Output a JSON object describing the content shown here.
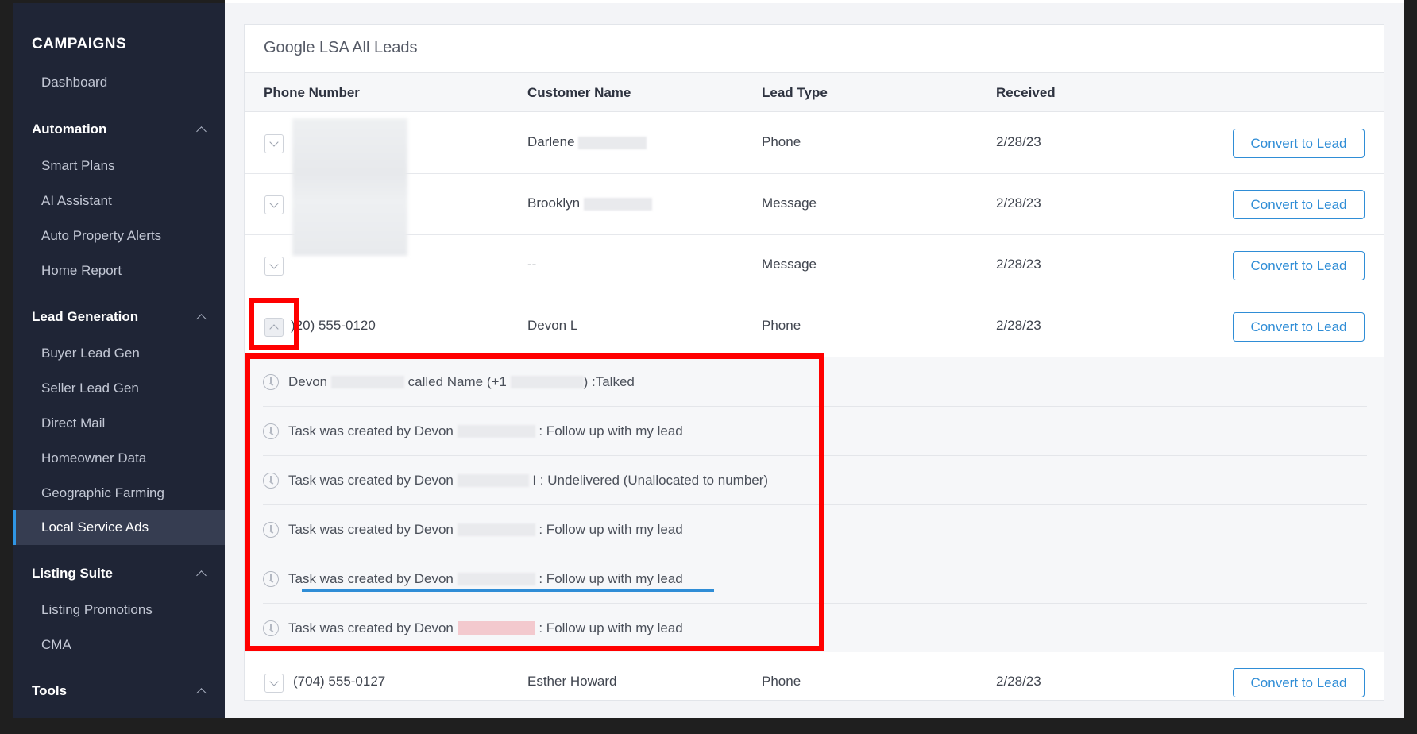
{
  "sidebar": {
    "title": "CAMPAIGNS",
    "dashboard": "Dashboard",
    "sections": {
      "automation": "Automation",
      "lead_generation": "Lead Generation",
      "listing_suite": "Listing Suite",
      "tools": "Tools"
    },
    "automation_items": [
      "Smart Plans",
      "AI Assistant",
      "Auto Property Alerts",
      "Home Report"
    ],
    "lead_gen_items": [
      "Buyer Lead Gen",
      "Seller Lead Gen",
      "Direct Mail",
      "Homeowner Data",
      "Geographic Farming",
      "Local Service Ads"
    ],
    "listing_items": [
      "Listing Promotions",
      "CMA"
    ],
    "active_item": "Local Service Ads"
  },
  "card": {
    "title": "Google LSA All Leads",
    "columns": [
      "Phone Number",
      "Customer Name",
      "Lead Type",
      "Received"
    ],
    "convert_label": "Convert to Lead",
    "rows": [
      {
        "phone": "",
        "name": "Darlene",
        "type": "Phone",
        "received": "2/28/23"
      },
      {
        "phone": "",
        "name": "Brooklyn",
        "type": "Message",
        "received": "2/28/23"
      },
      {
        "phone": "",
        "name": "--",
        "type": "Message",
        "received": "2/28/23"
      },
      {
        "phone": ")20) 555-0120",
        "name": "Devon L",
        "type": "Phone",
        "received": "2/28/23"
      },
      {
        "phone": "(704) 555-0127",
        "name": "Esther Howard",
        "type": "Phone",
        "received": "2/28/23"
      }
    ],
    "activities": [
      {
        "prefix": "Devon",
        "suffix": "called Name (+1",
        "tail": ") :Talked"
      },
      {
        "prefix": "Task was created by Devon",
        "suffix": ": Follow up with my lead"
      },
      {
        "prefix": "Task was created by Devon",
        "suffix": "I : Undelivered (Unallocated to number)"
      },
      {
        "prefix": "Task was created by Devon",
        "suffix": ": Follow up with my lead"
      },
      {
        "prefix": "Task was created by Devon",
        "suffix": ": Follow up with my lead"
      },
      {
        "prefix": "Task was created by Devon",
        "suffix": ": Follow up with my lead"
      }
    ]
  },
  "colors": {
    "sidebar_bg": "#1f2536",
    "accent": "#2f8dd6",
    "highlight": "#ff0000"
  }
}
